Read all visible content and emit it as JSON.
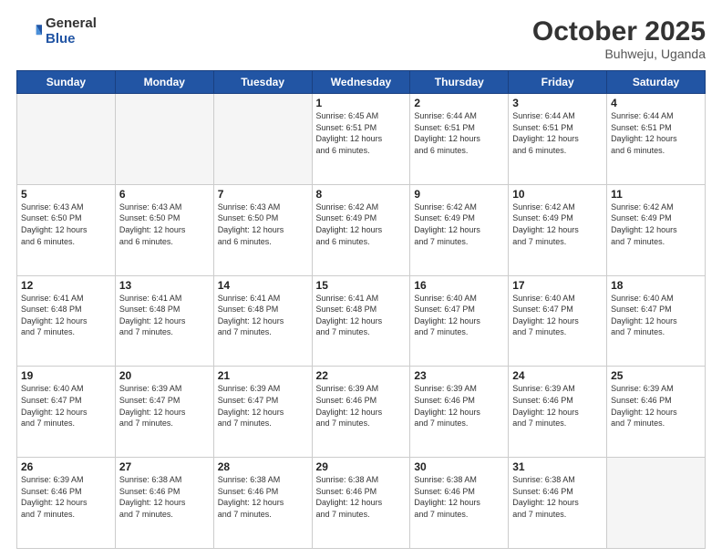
{
  "header": {
    "logo_general": "General",
    "logo_blue": "Blue",
    "month_title": "October 2025",
    "location": "Buhweju, Uganda"
  },
  "days_of_week": [
    "Sunday",
    "Monday",
    "Tuesday",
    "Wednesday",
    "Thursday",
    "Friday",
    "Saturday"
  ],
  "weeks": [
    [
      {
        "day": "",
        "info": ""
      },
      {
        "day": "",
        "info": ""
      },
      {
        "day": "",
        "info": ""
      },
      {
        "day": "1",
        "info": "Sunrise: 6:45 AM\nSunset: 6:51 PM\nDaylight: 12 hours\nand 6 minutes."
      },
      {
        "day": "2",
        "info": "Sunrise: 6:44 AM\nSunset: 6:51 PM\nDaylight: 12 hours\nand 6 minutes."
      },
      {
        "day": "3",
        "info": "Sunrise: 6:44 AM\nSunset: 6:51 PM\nDaylight: 12 hours\nand 6 minutes."
      },
      {
        "day": "4",
        "info": "Sunrise: 6:44 AM\nSunset: 6:51 PM\nDaylight: 12 hours\nand 6 minutes."
      }
    ],
    [
      {
        "day": "5",
        "info": "Sunrise: 6:43 AM\nSunset: 6:50 PM\nDaylight: 12 hours\nand 6 minutes."
      },
      {
        "day": "6",
        "info": "Sunrise: 6:43 AM\nSunset: 6:50 PM\nDaylight: 12 hours\nand 6 minutes."
      },
      {
        "day": "7",
        "info": "Sunrise: 6:43 AM\nSunset: 6:50 PM\nDaylight: 12 hours\nand 6 minutes."
      },
      {
        "day": "8",
        "info": "Sunrise: 6:42 AM\nSunset: 6:49 PM\nDaylight: 12 hours\nand 6 minutes."
      },
      {
        "day": "9",
        "info": "Sunrise: 6:42 AM\nSunset: 6:49 PM\nDaylight: 12 hours\nand 7 minutes."
      },
      {
        "day": "10",
        "info": "Sunrise: 6:42 AM\nSunset: 6:49 PM\nDaylight: 12 hours\nand 7 minutes."
      },
      {
        "day": "11",
        "info": "Sunrise: 6:42 AM\nSunset: 6:49 PM\nDaylight: 12 hours\nand 7 minutes."
      }
    ],
    [
      {
        "day": "12",
        "info": "Sunrise: 6:41 AM\nSunset: 6:48 PM\nDaylight: 12 hours\nand 7 minutes."
      },
      {
        "day": "13",
        "info": "Sunrise: 6:41 AM\nSunset: 6:48 PM\nDaylight: 12 hours\nand 7 minutes."
      },
      {
        "day": "14",
        "info": "Sunrise: 6:41 AM\nSunset: 6:48 PM\nDaylight: 12 hours\nand 7 minutes."
      },
      {
        "day": "15",
        "info": "Sunrise: 6:41 AM\nSunset: 6:48 PM\nDaylight: 12 hours\nand 7 minutes."
      },
      {
        "day": "16",
        "info": "Sunrise: 6:40 AM\nSunset: 6:47 PM\nDaylight: 12 hours\nand 7 minutes."
      },
      {
        "day": "17",
        "info": "Sunrise: 6:40 AM\nSunset: 6:47 PM\nDaylight: 12 hours\nand 7 minutes."
      },
      {
        "day": "18",
        "info": "Sunrise: 6:40 AM\nSunset: 6:47 PM\nDaylight: 12 hours\nand 7 minutes."
      }
    ],
    [
      {
        "day": "19",
        "info": "Sunrise: 6:40 AM\nSunset: 6:47 PM\nDaylight: 12 hours\nand 7 minutes."
      },
      {
        "day": "20",
        "info": "Sunrise: 6:39 AM\nSunset: 6:47 PM\nDaylight: 12 hours\nand 7 minutes."
      },
      {
        "day": "21",
        "info": "Sunrise: 6:39 AM\nSunset: 6:47 PM\nDaylight: 12 hours\nand 7 minutes."
      },
      {
        "day": "22",
        "info": "Sunrise: 6:39 AM\nSunset: 6:46 PM\nDaylight: 12 hours\nand 7 minutes."
      },
      {
        "day": "23",
        "info": "Sunrise: 6:39 AM\nSunset: 6:46 PM\nDaylight: 12 hours\nand 7 minutes."
      },
      {
        "day": "24",
        "info": "Sunrise: 6:39 AM\nSunset: 6:46 PM\nDaylight: 12 hours\nand 7 minutes."
      },
      {
        "day": "25",
        "info": "Sunrise: 6:39 AM\nSunset: 6:46 PM\nDaylight: 12 hours\nand 7 minutes."
      }
    ],
    [
      {
        "day": "26",
        "info": "Sunrise: 6:39 AM\nSunset: 6:46 PM\nDaylight: 12 hours\nand 7 minutes."
      },
      {
        "day": "27",
        "info": "Sunrise: 6:38 AM\nSunset: 6:46 PM\nDaylight: 12 hours\nand 7 minutes."
      },
      {
        "day": "28",
        "info": "Sunrise: 6:38 AM\nSunset: 6:46 PM\nDaylight: 12 hours\nand 7 minutes."
      },
      {
        "day": "29",
        "info": "Sunrise: 6:38 AM\nSunset: 6:46 PM\nDaylight: 12 hours\nand 7 minutes."
      },
      {
        "day": "30",
        "info": "Sunrise: 6:38 AM\nSunset: 6:46 PM\nDaylight: 12 hours\nand 7 minutes."
      },
      {
        "day": "31",
        "info": "Sunrise: 6:38 AM\nSunset: 6:46 PM\nDaylight: 12 hours\nand 7 minutes."
      },
      {
        "day": "",
        "info": ""
      }
    ]
  ]
}
